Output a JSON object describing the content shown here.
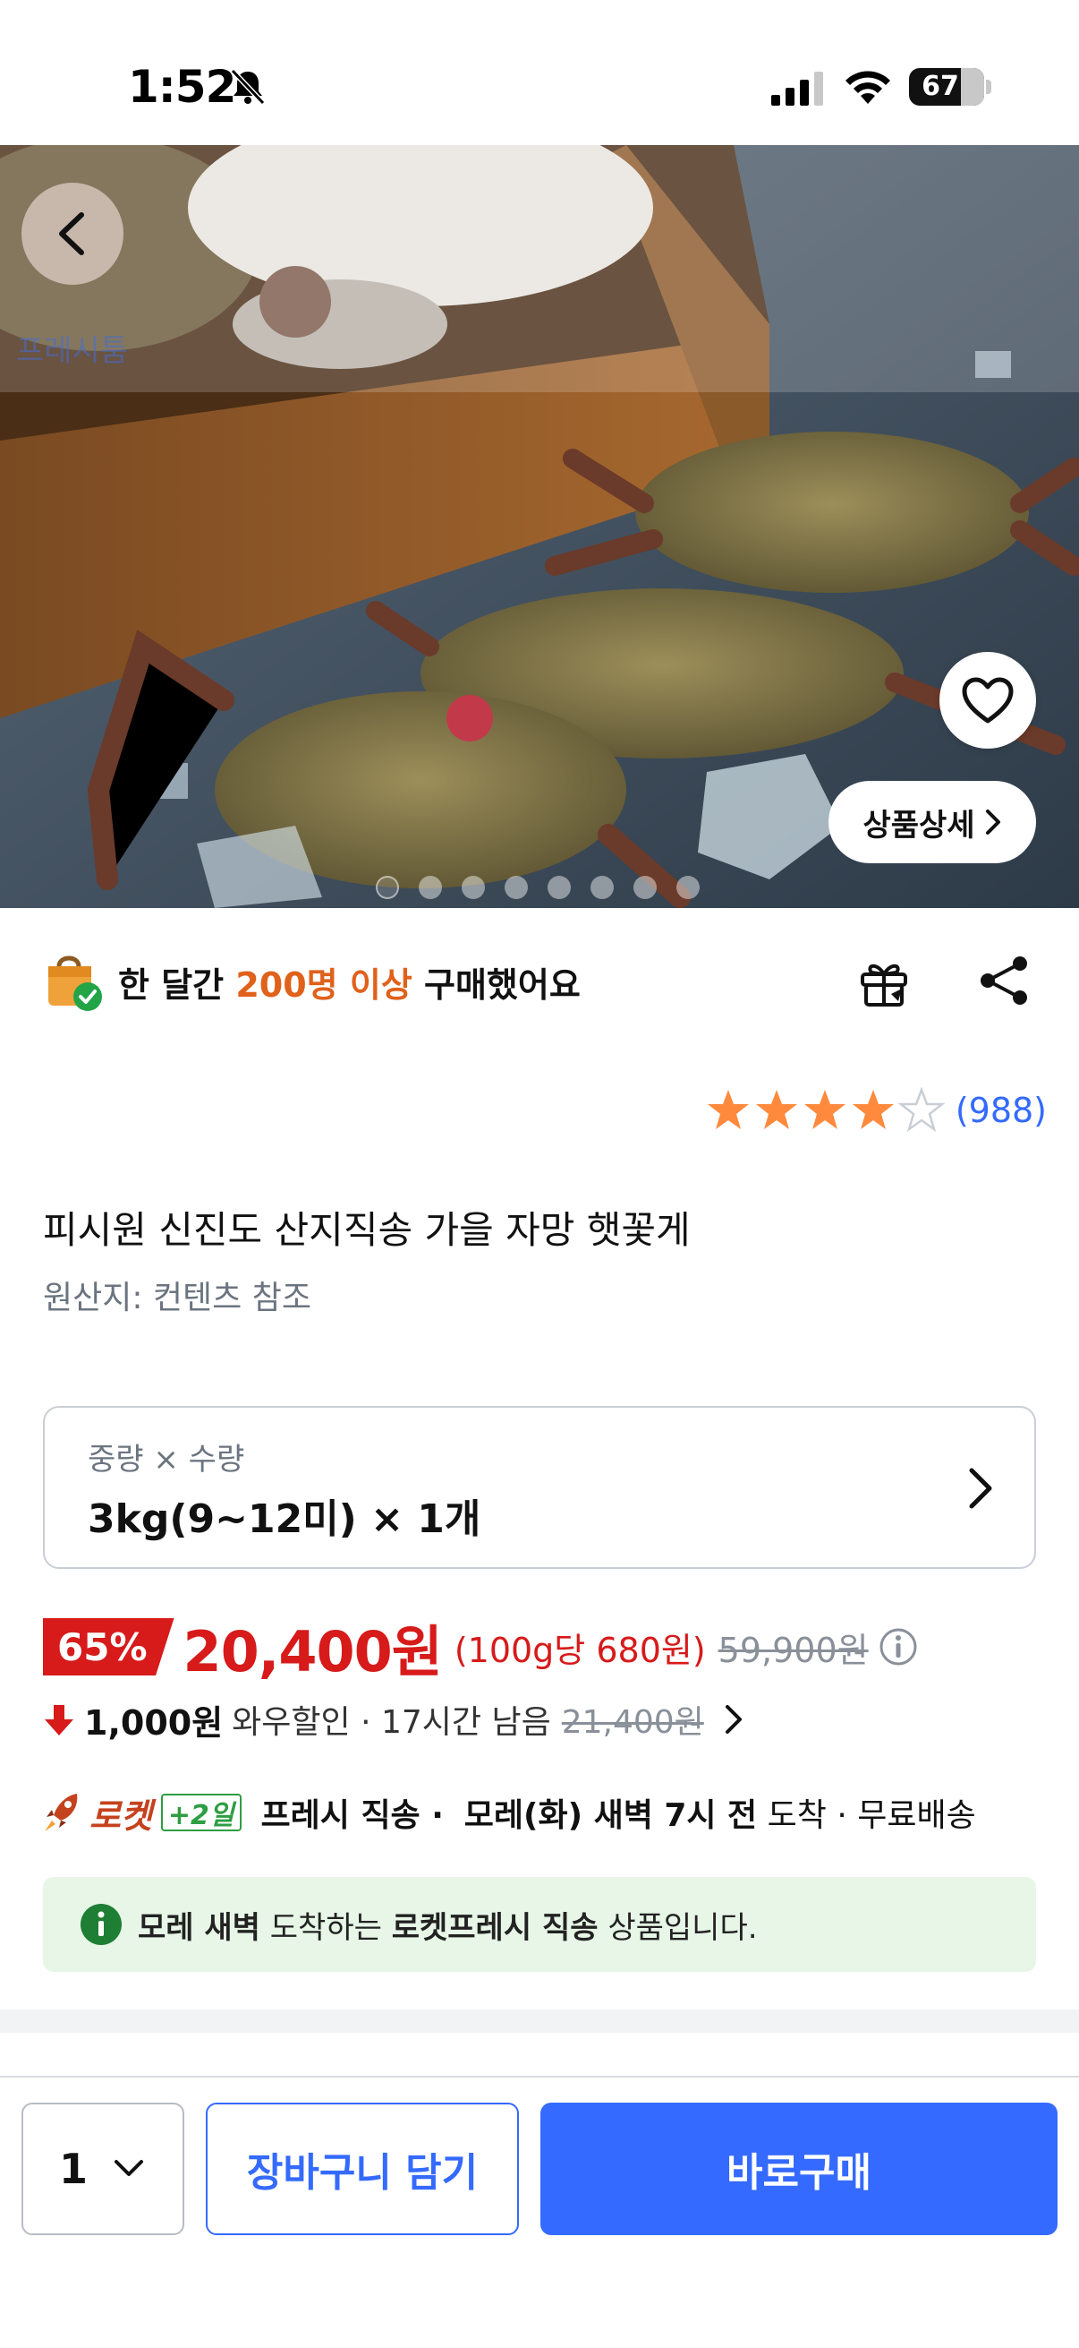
{
  "status_bar": {
    "time": "1:52",
    "battery": "67",
    "battery_level": 0.67
  },
  "hero": {
    "overlay_caption": "프레시툼",
    "detail_button_label": "상품상세",
    "image_count": 8,
    "active_index": 0
  },
  "purchase_badge": {
    "prefix": "한 달간 ",
    "highlight": "200명 이상",
    "suffix": " 구매했어요"
  },
  "rating": {
    "stars": 4,
    "max_stars": 5,
    "count": "(988)"
  },
  "product": {
    "title": "피시원 신진도 산지직송 가을 자망 햇꽃게",
    "origin": "원산지: 컨텐츠 참조"
  },
  "option": {
    "label": "중량 × 수량",
    "value": "3kg(9~12미) × 1개"
  },
  "price": {
    "discount": "65%",
    "sale_price": "20,400원",
    "unit_price": "(100g당 680원)",
    "original_price": "59,900원"
  },
  "coupon": {
    "amount": "1,000원",
    "description": "와우할인 · 17시간 남음",
    "original": "21,400원"
  },
  "delivery": {
    "rocket_label": "로켓",
    "plus_days": "+2일",
    "type": "프레시 직송 ·",
    "arrival": "모레(화) 새벽 7시 전",
    "arrival_suffix": "도착 · 무료배송"
  },
  "notice": {
    "bold1": "모레 새벽",
    "text1": " 도착하는 ",
    "bold2": "로켓프레시 직송",
    "text2": " 상품입니다."
  },
  "actions": {
    "quantity": "1",
    "cart_label": "장바구니 담기",
    "buy_label": "바로구매"
  },
  "colors": {
    "accent_blue": "#346aff",
    "sale_red": "#d71a1a",
    "star_orange": "#ff8a3d",
    "highlight_orange": "#e0611b",
    "notice_green": "#e7f6e7"
  }
}
